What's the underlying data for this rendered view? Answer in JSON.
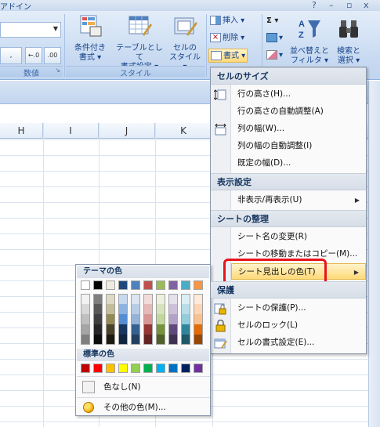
{
  "window": {
    "title_fragment": "アドイン",
    "controls": [
      "?",
      "–",
      "▫",
      "x"
    ]
  },
  "ribbon": {
    "number_group": {
      "label": "数値",
      "comma_label": ",",
      "inc_decimal_label": "←.0 .00",
      "dec_decimal_label": ".00 →.0"
    },
    "style_group": {
      "label": "スタイル",
      "buttons": [
        {
          "name": "conditional-format",
          "label_line1": "条件付き",
          "label_line2": "書式 ▾"
        },
        {
          "name": "format-as-table",
          "label_line1": "テーブルとして",
          "label_line2": "書式設定 ▾"
        },
        {
          "name": "cell-styles",
          "label_line1": "セルの",
          "label_line2": "スタイル ▾"
        }
      ]
    },
    "cells_group": {
      "insert_label": "挿入 ▾",
      "delete_label": "削除 ▾",
      "format_label": "書式 ▾"
    },
    "editing_group": {
      "sum_label": "Σ ▾",
      "fill_label": "▾",
      "clear_label": "▾",
      "sort_label_line1": "並べ替えと",
      "sort_label_line2": "フィルタ ▾",
      "find_label_line1": "検索と",
      "find_label_line2": "選択 ▾"
    }
  },
  "sheet": {
    "columns": [
      "H",
      "I",
      "J",
      "K"
    ]
  },
  "format_menu": {
    "sections": [
      {
        "title": "セルのサイズ",
        "items": [
          {
            "label": "行の高さ(H)...",
            "icon": "row-height-icon"
          },
          {
            "label": "行の高さの自動調整(A)"
          },
          {
            "label": "列の幅(W)...",
            "icon": "column-width-icon"
          },
          {
            "label": "列の幅の自動調整(I)"
          },
          {
            "label": "既定の幅(D)..."
          }
        ]
      },
      {
        "title": "表示設定",
        "items": [
          {
            "label": "非表示/再表示(U)",
            "submenu": true
          }
        ]
      },
      {
        "title": "シートの整理",
        "items": [
          {
            "label": "シート名の変更(R)"
          },
          {
            "label": "シートの移動またはコピー(M)..."
          },
          {
            "label": "シート見出しの色(T)",
            "submenu": true,
            "highlighted": true
          }
        ]
      },
      {
        "title": "保護",
        "items": [
          {
            "label": "シートの保護(P)...",
            "icon": "protect-sheet-icon"
          },
          {
            "label": "セルのロック(L)",
            "icon": "lock-icon"
          },
          {
            "label": "セルの書式設定(E)...",
            "icon": "format-cells-icon"
          }
        ]
      }
    ]
  },
  "tab_color_menu": {
    "theme_title": "テーマの色",
    "standard_title": "標準の色",
    "theme_colors": [
      "#ffffff",
      "#000000",
      "#eeece1",
      "#1f497d",
      "#4f81bd",
      "#c0504d",
      "#9bbb59",
      "#8064a2",
      "#4bacc6",
      "#f79646"
    ],
    "theme_shades": [
      [
        "#f2f2f2",
        "#d8d8d8",
        "#bfbfbf",
        "#a5a5a5",
        "#7f7f7f"
      ],
      [
        "#7f7f7f",
        "#595959",
        "#3f3f3f",
        "#262626",
        "#0c0c0c"
      ],
      [
        "#ddd9c3",
        "#c4bd97",
        "#938953",
        "#494429",
        "#1d1b10"
      ],
      [
        "#c6d9f0",
        "#8db3e2",
        "#548dd4",
        "#17365d",
        "#0f243e"
      ],
      [
        "#dbe5f1",
        "#b8cce4",
        "#95b3d7",
        "#366092",
        "#244061"
      ],
      [
        "#f2dcdb",
        "#e5b9b7",
        "#d99694",
        "#953734",
        "#632423"
      ],
      [
        "#ebf1dd",
        "#d7e3bc",
        "#c3d69b",
        "#76923c",
        "#4f6128"
      ],
      [
        "#e5e0ec",
        "#ccc1d9",
        "#b2a2c7",
        "#5f497a",
        "#3f3151"
      ],
      [
        "#dbeef3",
        "#b7dde8",
        "#92cddc",
        "#31859b",
        "#205867"
      ],
      [
        "#fdeada",
        "#fbd5b5",
        "#fac08f",
        "#e36c09",
        "#974806"
      ]
    ],
    "standard_colors": [
      "#c00000",
      "#ff0000",
      "#ffc000",
      "#ffff00",
      "#92d050",
      "#00b050",
      "#00b0f0",
      "#0070c0",
      "#002060",
      "#7030a0"
    ],
    "no_color_label": "色なし(N)",
    "more_colors_label": "その他の色(M)..."
  }
}
